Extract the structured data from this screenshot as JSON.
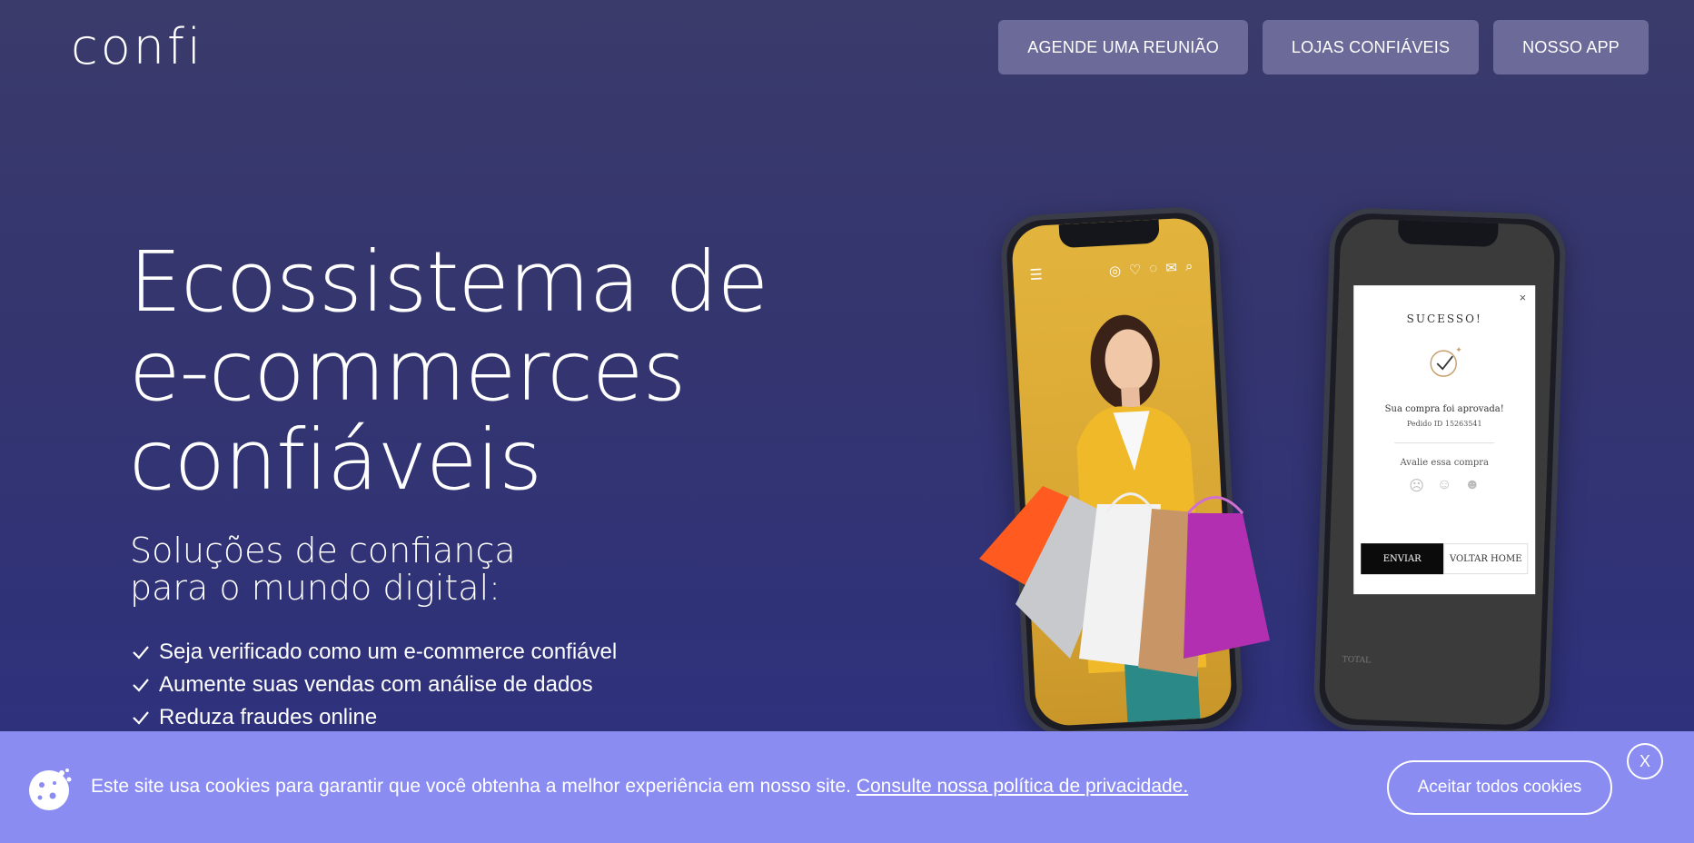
{
  "header": {
    "logo": "confi",
    "nav": [
      {
        "label": "AGENDE UMA REUNIÃO"
      },
      {
        "label": "LOJAS CONFIÁVEIS"
      },
      {
        "label": "NOSSO APP"
      }
    ]
  },
  "hero": {
    "title": "Ecossistema de\ne-commerces\nconfiáveis",
    "subtitle": "Soluções de confiança\npara o mundo digital:",
    "features": [
      "Seja verificado como um e-commerce confiável",
      "Aumente suas vendas com análise de dados",
      "Reduza fraudes online"
    ]
  },
  "phone_success": {
    "title": "SUCESSO!",
    "close": "×",
    "message": "Sua compra foi aprovada!",
    "order": "Pedido ID  15263541",
    "rate_label": "Avalie essa compra",
    "send_label": "ENVIAR",
    "home_label": "VOLTAR HOME",
    "total_label": "TOTAL"
  },
  "cookie_banner": {
    "text": "Este site usa cookies para garantir que você obtenha a melhor experiência em nosso site.",
    "link": "Consulte nossa política de privacidade.",
    "accept_label": "Aceitar todos cookies",
    "close_label": "X"
  },
  "colors": {
    "background": "#34356f",
    "nav_button": "#6b6a98",
    "cookie_banner": "#8a8cf2"
  }
}
